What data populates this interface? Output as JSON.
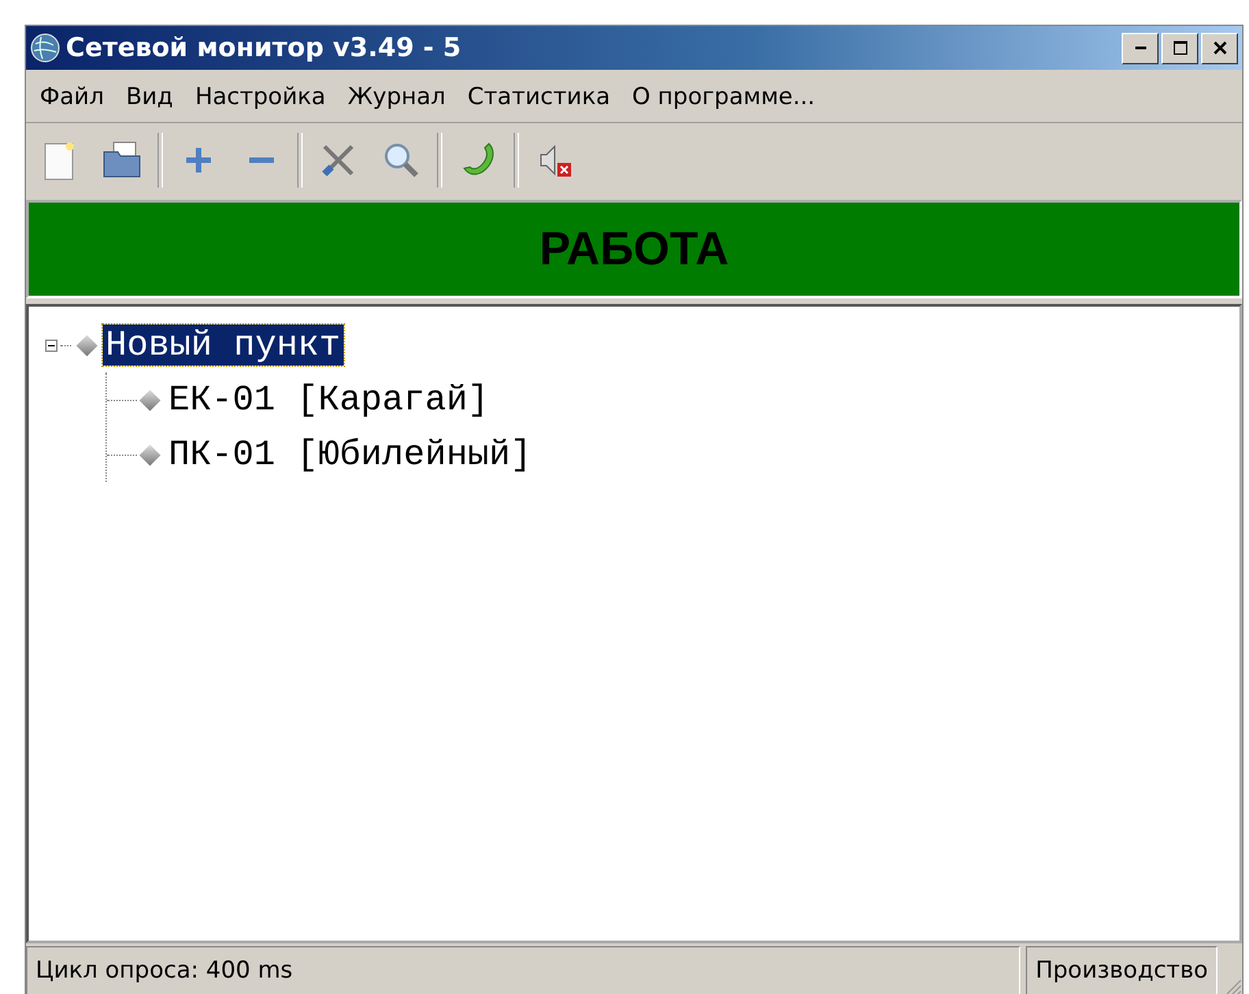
{
  "window": {
    "title": "Сетевой монитор v3.49  -  5"
  },
  "menu": [
    "Файл",
    "Вид",
    "Настройка",
    "Журнал",
    "Статистика",
    "О программе..."
  ],
  "toolbar": [
    {
      "kind": "new"
    },
    {
      "kind": "open"
    },
    {
      "kind": "sep"
    },
    {
      "kind": "add"
    },
    {
      "kind": "remove"
    },
    {
      "kind": "sep"
    },
    {
      "kind": "tools"
    },
    {
      "kind": "search"
    },
    {
      "kind": "sep"
    },
    {
      "kind": "phone"
    },
    {
      "kind": "sep"
    },
    {
      "kind": "mute"
    }
  ],
  "banner": {
    "text": "РАБОТА",
    "color": "#007c00"
  },
  "tree": [
    {
      "label": "Новый пункт",
      "selected": true,
      "expanded": true,
      "children": [
        {
          "label": "ЕК-01 [Карагай]",
          "selected": false
        },
        {
          "label": "ПК-01 [Юбилейный]",
          "selected": false
        }
      ]
    }
  ],
  "status_bar": [
    "Цикл опроса: 400 ms",
    "Производство"
  ]
}
